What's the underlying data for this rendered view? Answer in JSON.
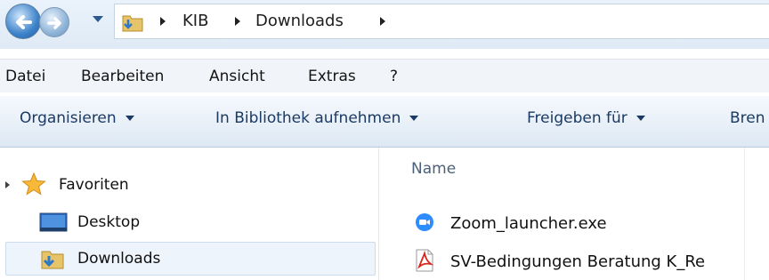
{
  "address": {
    "back_icon": "back-arrow-icon",
    "forward_icon": "forward-arrow-icon",
    "breadcrumbs": [
      "KIB",
      "Downloads"
    ]
  },
  "menu": {
    "items": [
      "Datei",
      "Bearbeiten",
      "Ansicht",
      "Extras",
      "?"
    ]
  },
  "toolbar": {
    "organize": "Organisieren",
    "library": "In Bibliothek aufnehmen",
    "share": "Freigeben für",
    "burn_partial": "Bren"
  },
  "navigation": {
    "favorites": "Favoriten",
    "desktop": "Desktop",
    "downloads": "Downloads",
    "selected": "Downloads"
  },
  "files": {
    "column_name": "Name",
    "items": [
      {
        "name": "Zoom_launcher.exe",
        "icon": "zoom-app-icon"
      },
      {
        "name": "SV-Bedingungen Beratung K_Re",
        "icon": "pdf-file-icon"
      }
    ]
  },
  "colors": {
    "toolbar_text": "#1b3a63",
    "selection_bg": "#eef4fb",
    "zoom_blue": "#2d8cff",
    "pdf_red": "#d9251c"
  }
}
